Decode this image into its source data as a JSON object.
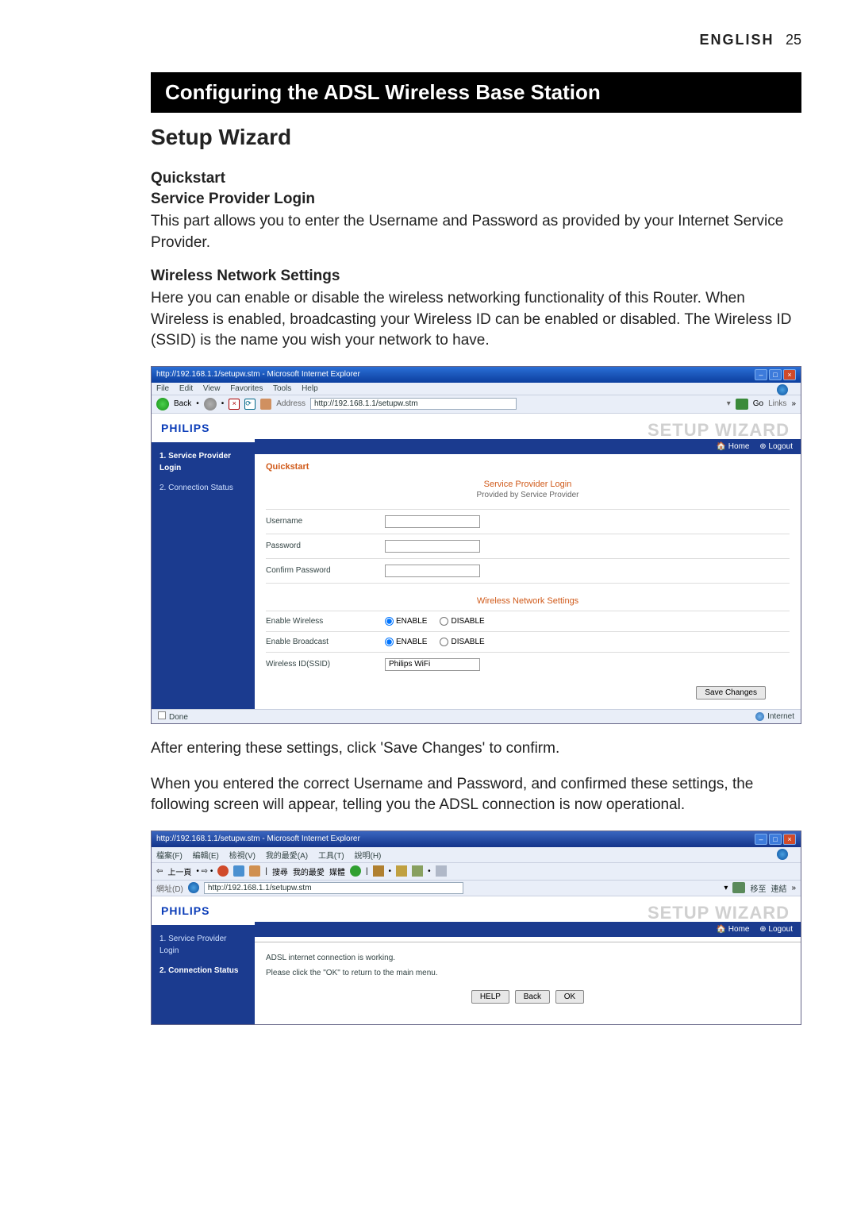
{
  "header": {
    "language": "ENGLISH",
    "page": "25"
  },
  "bar_title": "Configuring the ADSL Wireless Base Station",
  "section_title": "Setup Wizard",
  "quickstart": "Quickstart",
  "spl": {
    "heading": "Service Provider Login",
    "text": "This part allows you to enter the Username and Password as provided by your Internet Service Provider."
  },
  "wns": {
    "heading": "Wireless Network Settings",
    "text": "Here you can enable or disable the wireless networking functionality of this Router. When Wireless is enabled, broadcasting your Wireless ID can be enabled or disabled. The Wireless ID (SSID) is the name you wish your network to have."
  },
  "browser1": {
    "title": "http://192.168.1.1/setupw.stm - Microsoft Internet Explorer",
    "menu": [
      "File",
      "Edit",
      "View",
      "Favorites",
      "Tools",
      "Help"
    ],
    "back": "Back",
    "address_label": "Address",
    "address": "http://192.168.1.1/setupw.stm",
    "go": "Go",
    "links": "Links",
    "brand": "PHILIPS",
    "wizard": "SETUP WIZARD",
    "headlinks": {
      "home": "🏠 Home",
      "logout": "⊕ Logout"
    },
    "sidebar": [
      {
        "label": "1. Service Provider Login",
        "active": true
      },
      {
        "label": "2. Connection Status",
        "active": false
      }
    ],
    "quickstart": "Quickstart",
    "spl_title": "Service Provider Login",
    "spl_sub": "Provided by Service Provider",
    "fields": {
      "username": "Username",
      "password": "Password",
      "confirm": "Confirm Password"
    },
    "wns_title": "Wireless Network Settings",
    "enable_wireless": "Enable Wireless",
    "enable_broadcast": "Enable Broadcast",
    "ssid_label": "Wireless ID(SSID)",
    "ssid_value": "Philips WiFi",
    "enable": "ENABLE",
    "disable": "DISABLE",
    "save": "Save Changes",
    "status_done": "Done",
    "status_zone": "Internet"
  },
  "after_text": "After entering these settings, click 'Save Changes' to confirm.",
  "confirm_text": "When you entered the correct Username and Password, and confirmed these settings, the following screen will appear, telling you the ADSL connection is now operational.",
  "browser2": {
    "title": "http://192.168.1.1/setupw.stm - Microsoft Internet Explorer",
    "menu": [
      "檔案(F)",
      "編輯(E)",
      "檢視(V)",
      "我的最愛(A)",
      "工具(T)",
      "說明(H)"
    ],
    "tb": [
      "上一頁",
      "搜尋",
      "我的最愛",
      "媒體"
    ],
    "address_label": "網址(D)",
    "address": "http://192.168.1.1/setupw.stm",
    "go": "移至",
    "links": "連結",
    "brand": "PHILIPS",
    "wizard": "SETUP WIZARD",
    "headlinks": {
      "home": "🏠 Home",
      "logout": "⊕ Logout"
    },
    "sidebar": [
      {
        "label": "1. Service Provider Login",
        "active": false
      },
      {
        "label": "2. Connection Status",
        "active": true
      }
    ],
    "msg1": "ADSL internet connection is working.",
    "msg2": "Please click the \"OK\" to return to the main menu.",
    "btn_help": "HELP",
    "btn_back": "Back",
    "btn_ok": "OK"
  }
}
